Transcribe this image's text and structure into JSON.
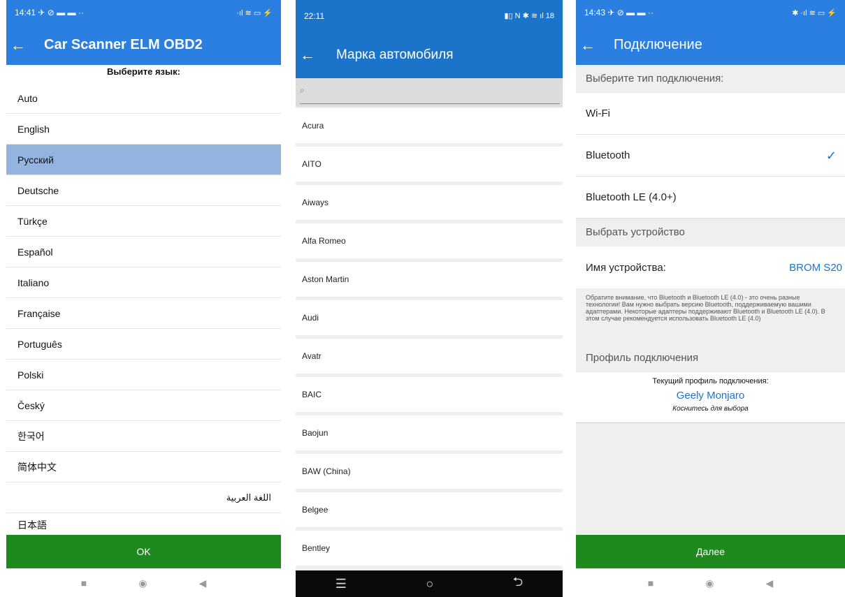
{
  "colors": {
    "appbar": "#2a7fe0",
    "selected_row": "#94b4e0",
    "accent": "#1b74c9",
    "confirm_button": "#1e8a1e"
  },
  "language_screen": {
    "status": {
      "time": "14:41",
      "icons_left": "✈ ⊘ ▬ ▬ ··",
      "icons_right": "·ıl ≋ ▭ ⚡"
    },
    "title": "Car Scanner ELM OBD2",
    "back_icon": "arrow-left-icon",
    "header": "Выберите язык:",
    "languages": [
      {
        "label": "Auto"
      },
      {
        "label": "English"
      },
      {
        "label": "Русский"
      },
      {
        "label": "Deutsche"
      },
      {
        "label": "Türkçe"
      },
      {
        "label": "Español"
      },
      {
        "label": "Italiano"
      },
      {
        "label": "Française"
      },
      {
        "label": "Português"
      },
      {
        "label": "Polski"
      },
      {
        "label": "Český"
      },
      {
        "label": "한국어"
      },
      {
        "label": "简体中文"
      },
      {
        "label": "اللغة العربية"
      },
      {
        "label": "日本語"
      }
    ],
    "selected_language": "Русский",
    "ok_label": "OK",
    "nav": {
      "square": "■",
      "circle": "◉",
      "back": "◀"
    }
  },
  "brand_screen": {
    "status": {
      "time": "22:11",
      "icons_right": "▮▯ N ✱ ≋ ıl 18"
    },
    "title": "Марка автомобиля",
    "search_placeholder": "",
    "brands": [
      {
        "label": "Acura"
      },
      {
        "label": "AITO"
      },
      {
        "label": "Aiways"
      },
      {
        "label": "Alfa Romeo"
      },
      {
        "label": "Aston Martin"
      },
      {
        "label": "Audi"
      },
      {
        "label": "Avatr"
      },
      {
        "label": "BAIC"
      },
      {
        "label": "Baojun"
      },
      {
        "label": "BAW (China)"
      },
      {
        "label": "Belgee"
      },
      {
        "label": "Bentley"
      }
    ],
    "nav": {
      "menu": "☰",
      "home": "○",
      "back": "⮌"
    }
  },
  "connection_screen": {
    "status": {
      "time": "14:43",
      "icons_left": "✈ ⊘ ▬ ▬ ··",
      "icons_right": "✱ ·ıl ≋ ▭ ⚡"
    },
    "title": "Подключение",
    "type_header": "Выберите тип подключения:",
    "options": [
      {
        "label": "Wi-Fi",
        "checked": ""
      },
      {
        "label": "Bluetooth",
        "checked": "✓"
      },
      {
        "label": "Bluetooth LE (4.0+)",
        "checked": ""
      }
    ],
    "device_header": "Выбрать устройство",
    "device_label": "Имя устройства:",
    "device_value": "BROM S20",
    "note": "Обратите внимание, что Bluetooth и Bluetooth LE (4.0) - это очень разные технологии! Вам нужно выбрать версию Bluetooth, поддерживаемую вашими адаптерами. Некоторые адаптеры поддерживают Bluetooth и Bluetooth LE (4.0). В этом случае рекомендуется использовать Bluetooth LE (4.0)",
    "profile_header": "Профиль подключения",
    "profile_label": "Текущий профиль подключения:",
    "profile_name": "Geely Monjaro",
    "profile_hint": "Коснитесь для выбора",
    "next_label": "Далее",
    "nav": {
      "square": "■",
      "circle": "◉",
      "back": "◀"
    }
  }
}
